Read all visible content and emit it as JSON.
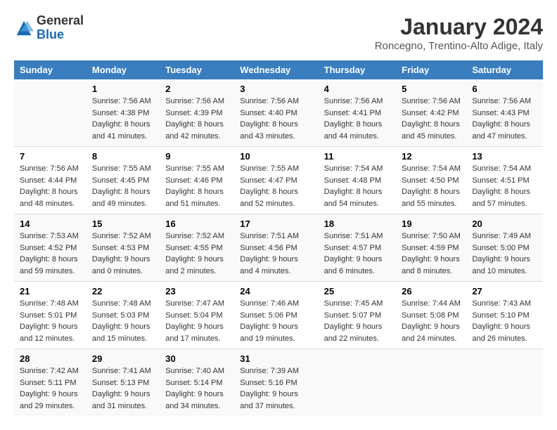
{
  "header": {
    "logo_general": "General",
    "logo_blue": "Blue",
    "title": "January 2024",
    "location": "Roncegno, Trentino-Alto Adige, Italy"
  },
  "days_of_week": [
    "Sunday",
    "Monday",
    "Tuesday",
    "Wednesday",
    "Thursday",
    "Friday",
    "Saturday"
  ],
  "weeks": [
    [
      {
        "num": "",
        "sunrise": "",
        "sunset": "",
        "daylight": ""
      },
      {
        "num": "1",
        "sunrise": "7:56 AM",
        "sunset": "4:38 PM",
        "daylight": "8 hours and 41 minutes."
      },
      {
        "num": "2",
        "sunrise": "7:56 AM",
        "sunset": "4:39 PM",
        "daylight": "8 hours and 42 minutes."
      },
      {
        "num": "3",
        "sunrise": "7:56 AM",
        "sunset": "4:40 PM",
        "daylight": "8 hours and 43 minutes."
      },
      {
        "num": "4",
        "sunrise": "7:56 AM",
        "sunset": "4:41 PM",
        "daylight": "8 hours and 44 minutes."
      },
      {
        "num": "5",
        "sunrise": "7:56 AM",
        "sunset": "4:42 PM",
        "daylight": "8 hours and 45 minutes."
      },
      {
        "num": "6",
        "sunrise": "7:56 AM",
        "sunset": "4:43 PM",
        "daylight": "8 hours and 47 minutes."
      }
    ],
    [
      {
        "num": "7",
        "sunrise": "7:56 AM",
        "sunset": "4:44 PM",
        "daylight": "8 hours and 48 minutes."
      },
      {
        "num": "8",
        "sunrise": "7:55 AM",
        "sunset": "4:45 PM",
        "daylight": "8 hours and 49 minutes."
      },
      {
        "num": "9",
        "sunrise": "7:55 AM",
        "sunset": "4:46 PM",
        "daylight": "8 hours and 51 minutes."
      },
      {
        "num": "10",
        "sunrise": "7:55 AM",
        "sunset": "4:47 PM",
        "daylight": "8 hours and 52 minutes."
      },
      {
        "num": "11",
        "sunrise": "7:54 AM",
        "sunset": "4:48 PM",
        "daylight": "8 hours and 54 minutes."
      },
      {
        "num": "12",
        "sunrise": "7:54 AM",
        "sunset": "4:50 PM",
        "daylight": "8 hours and 55 minutes."
      },
      {
        "num": "13",
        "sunrise": "7:54 AM",
        "sunset": "4:51 PM",
        "daylight": "8 hours and 57 minutes."
      }
    ],
    [
      {
        "num": "14",
        "sunrise": "7:53 AM",
        "sunset": "4:52 PM",
        "daylight": "8 hours and 59 minutes."
      },
      {
        "num": "15",
        "sunrise": "7:52 AM",
        "sunset": "4:53 PM",
        "daylight": "9 hours and 0 minutes."
      },
      {
        "num": "16",
        "sunrise": "7:52 AM",
        "sunset": "4:55 PM",
        "daylight": "9 hours and 2 minutes."
      },
      {
        "num": "17",
        "sunrise": "7:51 AM",
        "sunset": "4:56 PM",
        "daylight": "9 hours and 4 minutes."
      },
      {
        "num": "18",
        "sunrise": "7:51 AM",
        "sunset": "4:57 PM",
        "daylight": "9 hours and 6 minutes."
      },
      {
        "num": "19",
        "sunrise": "7:50 AM",
        "sunset": "4:59 PM",
        "daylight": "9 hours and 8 minutes."
      },
      {
        "num": "20",
        "sunrise": "7:49 AM",
        "sunset": "5:00 PM",
        "daylight": "9 hours and 10 minutes."
      }
    ],
    [
      {
        "num": "21",
        "sunrise": "7:48 AM",
        "sunset": "5:01 PM",
        "daylight": "9 hours and 12 minutes."
      },
      {
        "num": "22",
        "sunrise": "7:48 AM",
        "sunset": "5:03 PM",
        "daylight": "9 hours and 15 minutes."
      },
      {
        "num": "23",
        "sunrise": "7:47 AM",
        "sunset": "5:04 PM",
        "daylight": "9 hours and 17 minutes."
      },
      {
        "num": "24",
        "sunrise": "7:46 AM",
        "sunset": "5:06 PM",
        "daylight": "9 hours and 19 minutes."
      },
      {
        "num": "25",
        "sunrise": "7:45 AM",
        "sunset": "5:07 PM",
        "daylight": "9 hours and 22 minutes."
      },
      {
        "num": "26",
        "sunrise": "7:44 AM",
        "sunset": "5:08 PM",
        "daylight": "9 hours and 24 minutes."
      },
      {
        "num": "27",
        "sunrise": "7:43 AM",
        "sunset": "5:10 PM",
        "daylight": "9 hours and 26 minutes."
      }
    ],
    [
      {
        "num": "28",
        "sunrise": "7:42 AM",
        "sunset": "5:11 PM",
        "daylight": "9 hours and 29 minutes."
      },
      {
        "num": "29",
        "sunrise": "7:41 AM",
        "sunset": "5:13 PM",
        "daylight": "9 hours and 31 minutes."
      },
      {
        "num": "30",
        "sunrise": "7:40 AM",
        "sunset": "5:14 PM",
        "daylight": "9 hours and 34 minutes."
      },
      {
        "num": "31",
        "sunrise": "7:39 AM",
        "sunset": "5:16 PM",
        "daylight": "9 hours and 37 minutes."
      },
      {
        "num": "",
        "sunrise": "",
        "sunset": "",
        "daylight": ""
      },
      {
        "num": "",
        "sunrise": "",
        "sunset": "",
        "daylight": ""
      },
      {
        "num": "",
        "sunrise": "",
        "sunset": "",
        "daylight": ""
      }
    ]
  ]
}
